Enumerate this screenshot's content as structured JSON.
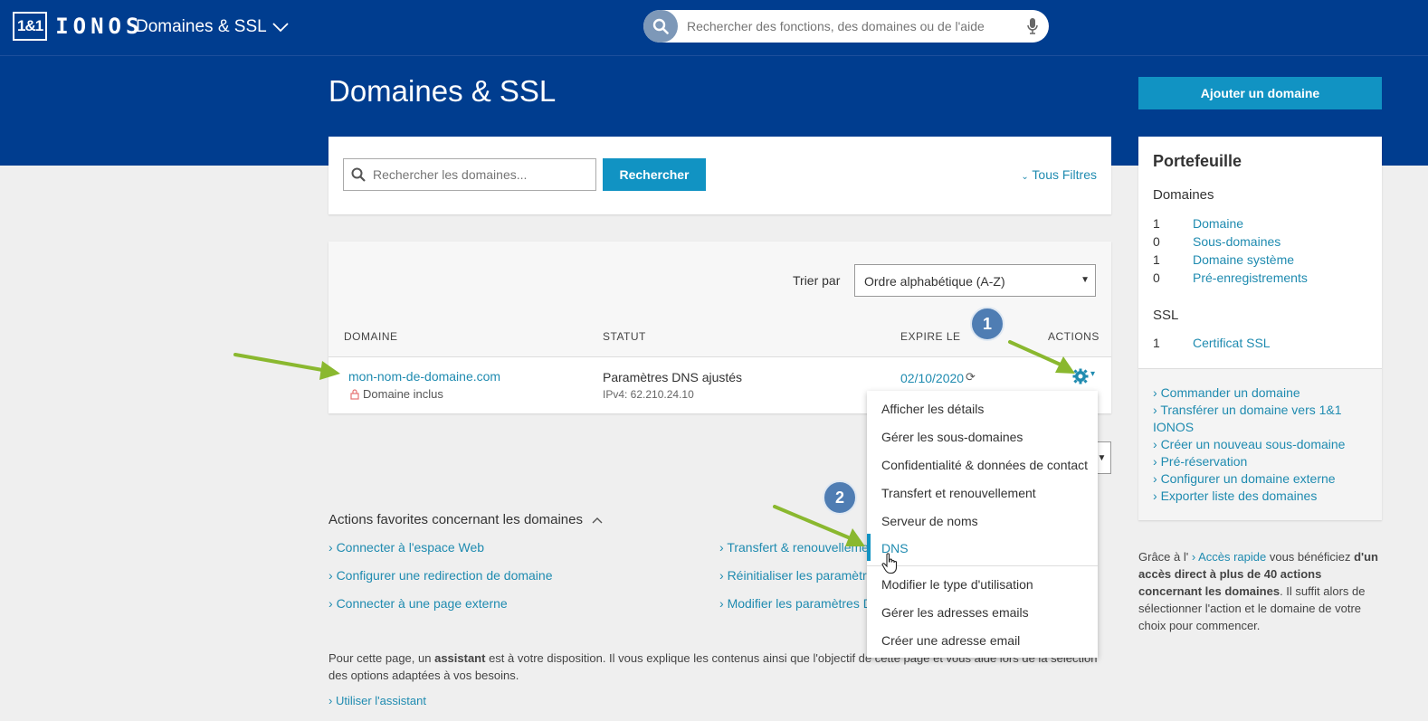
{
  "header": {
    "logo_box": "1&1",
    "logo_text": "IONOS",
    "product": "Domaines & SSL",
    "search_placeholder": "Rechercher des fonctions, des domaines ou de l'aide"
  },
  "page": {
    "title": "Domaines & SSL",
    "add_button": "Ajouter un domaine"
  },
  "domain_search": {
    "placeholder": "Rechercher les domaines...",
    "button": "Rechercher",
    "filters": "Tous Filtres"
  },
  "table": {
    "sort_label": "Trier par",
    "sort_value": "Ordre alphabétique (A-Z)",
    "columns": [
      "DOMAINE",
      "STATUT",
      "EXPIRE LE",
      "ACTIONS"
    ],
    "row": {
      "domain": "mon-nom-de-domaine.com",
      "included": "Domaine inclus",
      "status": "Paramètres DNS ajustés",
      "ip": "IPv4: 62.210.24.10",
      "expire": "02/10/2020"
    }
  },
  "badges": [
    "1",
    "2"
  ],
  "actions_menu": [
    "Afficher les détails",
    "Gérer les sous-domaines",
    "Confidentialité & données de contact",
    "Transfert et renouvellement",
    "Serveur de noms",
    "DNS",
    "Modifier le type d'utilisation",
    "Gérer les adresses emails",
    "Créer une adresse email"
  ],
  "favorites": {
    "title": "Actions favorites concernant les domaines",
    "left": [
      "Connecter à l'espace Web",
      "Configurer une redirection de domaine",
      "Connecter à une page externe"
    ],
    "right": [
      "Transfert & renouvellement",
      "Réinitialiser les paramètres",
      "Modifier les paramètres DNS"
    ]
  },
  "assistant": {
    "text_before": "Pour cette page, un ",
    "bold": "assistant",
    "text_after": " est à votre disposition. Il vous explique les contenus ainsi que l'objectif de cette page et vous aide lors de la sélection des options adaptées à vos besoins.",
    "link": "Utiliser l'assistant"
  },
  "portfolio": {
    "title": "Portefeuille",
    "domains_heading": "Domaines",
    "domains": [
      {
        "count": "1",
        "label": "Domaine"
      },
      {
        "count": "0",
        "label": "Sous-domaines"
      },
      {
        "count": "1",
        "label": "Domaine système"
      },
      {
        "count": "0",
        "label": "Pré-enregistrements"
      }
    ],
    "ssl_heading": "SSL",
    "ssl": [
      {
        "count": "1",
        "label": "Certificat SSL"
      }
    ],
    "links": [
      "Commander un domaine",
      "Transférer un domaine vers 1&1 IONOS",
      "Créer un nouveau sous-domaine",
      "Pré-réservation",
      "Configurer un domaine externe",
      "Exporter liste des domaines"
    ]
  },
  "quick_access": {
    "prefix": "Grâce à l' ",
    "link": "Accès rapide",
    "mid": " vous bénéficiez ",
    "bold": "d'un accès direct à plus de 40 actions concernant les domaines",
    "suffix": ". Il suffit alors de sélectionner l'action et le domaine de votre choix pour commencer."
  },
  "colors": {
    "brand": "#003d8f",
    "accent": "#1193c3",
    "arrow": "#8ab82f"
  }
}
